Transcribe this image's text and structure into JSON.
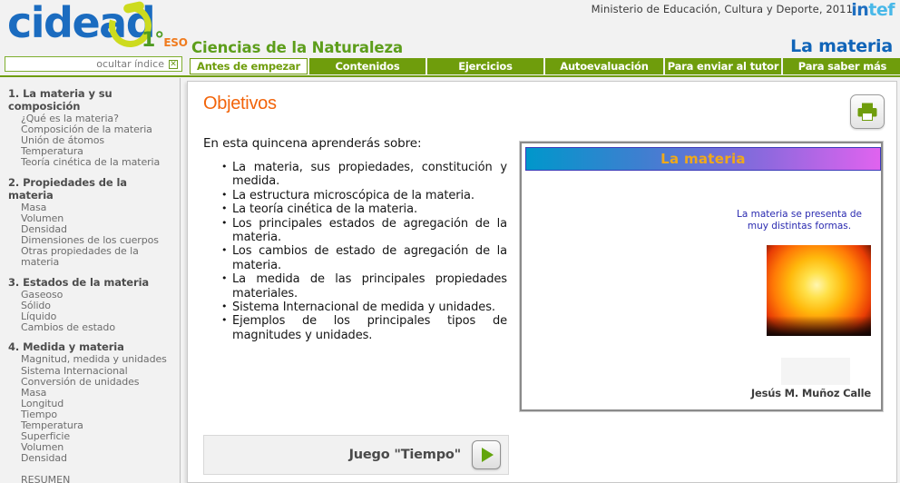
{
  "header": {
    "ministry": "Ministerio de Educación, Cultura y Deporte, 2011",
    "intef_in": "in",
    "intef_tef": "tef",
    "logo_word": "cidead",
    "logo_level": "1°",
    "logo_stage": "ESO",
    "subject_title": "Ciencias de la Naturaleza",
    "unit_title": "La materia",
    "hide_index_label": "ocultar índice",
    "hide_index_icon": "close-box-icon"
  },
  "tabs": [
    {
      "label": "Antes de empezar",
      "active": true
    },
    {
      "label": "Contenidos",
      "active": false
    },
    {
      "label": "Ejercicios",
      "active": false
    },
    {
      "label": "Autoevaluación",
      "active": false
    },
    {
      "label": "Para enviar al tutor",
      "active": false
    },
    {
      "label": "Para saber más",
      "active": false
    }
  ],
  "sidebar": {
    "groups": [
      {
        "number": "1.",
        "title": "1. La materia y su composición",
        "items": [
          "¿Qué es la materia?",
          "Composición de la materia",
          "Unión de átomos",
          "Temperatura",
          "Teoría cinética de la materia"
        ]
      },
      {
        "number": "2.",
        "title": "2. Propiedades de la materia",
        "items": [
          "Masa",
          "Volumen",
          "Densidad",
          "Dimensiones de los cuerpos",
          "Otras propiedades de la materia"
        ]
      },
      {
        "number": "3.",
        "title": "3. Estados de la materia",
        "items": [
          "Gaseoso",
          "Sólido",
          "Líquido",
          "Cambios de estado"
        ]
      },
      {
        "number": "4.",
        "title": "4. Medida y materia",
        "items": [
          "Magnitud, medida y unidades",
          "Sistema Internacional",
          "Conversión de unidades",
          "Masa",
          "Longitud",
          "Tiempo",
          "Temperatura",
          "Superficie",
          "Volumen",
          "Densidad"
        ]
      }
    ],
    "summary_label": "RESUMEN"
  },
  "main": {
    "heading": "Objetivos",
    "intro": "En esta quincena aprenderás sobre:",
    "bullets": [
      "La materia, sus propiedades, constitución y medida.",
      "La estructura microscópica de la materia.",
      "La teoría cinética de la materia.",
      "Los principales estados de agregación de la materia.",
      "Los cambios de estado de agregación de la materia.",
      "La medida de las principales propiedades materiales.",
      "Sistema Internacional de medida y unidades.",
      "Ejemplos de los principales tipos de magnitudes y unidades."
    ],
    "print_icon": "printer-icon"
  },
  "preview": {
    "title": "La materia",
    "caption": "La materia se presenta de muy distintas formas.",
    "image_name": "sun-fireball-image",
    "author": "Jesús M. Muñoz Calle"
  },
  "game": {
    "label": "Juego \"Tiempo\"",
    "play_icon": "play-icon"
  },
  "colors": {
    "green": "#6f9d0c",
    "blue": "#1064b8",
    "orange": "#f2640a",
    "logo_blue": "#1b6cc0",
    "logo_lime": "#cddb1e",
    "title_gold": "#f0a91a"
  }
}
